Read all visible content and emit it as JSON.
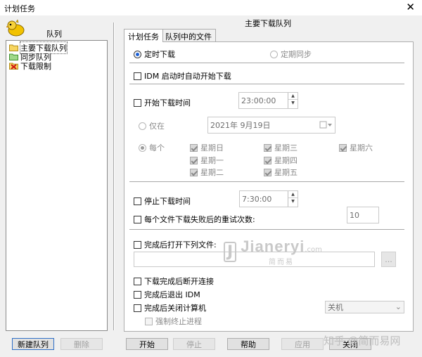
{
  "window": {
    "title": "计划任务",
    "close_glyph": "✕"
  },
  "left_panel": {
    "label": "队列",
    "items": [
      {
        "label": "主要下载队列",
        "icon": "folder-queue-icon"
      },
      {
        "label": "同步队列",
        "icon": "sync-queue-icon"
      },
      {
        "label": "下载限制",
        "icon": "limit-x-icon"
      }
    ],
    "new_queue_button": "新建队列",
    "delete_button": "删除"
  },
  "right_panel": {
    "title": "主要下载队列",
    "tabs": [
      "计划任务",
      "队列中的文件"
    ],
    "one_time_download": "定时下载",
    "periodic_sync": "定期同步",
    "start_on_idm_start": "IDM 启动时自动开始下载",
    "start_download_time": {
      "label": "开始下载时间",
      "value": "23:00:00"
    },
    "only_on": {
      "label": "仅在",
      "date": "2021年  9月19日"
    },
    "every": {
      "label": "每个",
      "days": [
        {
          "label": "星期日",
          "checked": true
        },
        {
          "label": "星期一",
          "checked": true
        },
        {
          "label": "星期二",
          "checked": true
        },
        {
          "label": "星期三",
          "checked": true
        },
        {
          "label": "星期四",
          "checked": true
        },
        {
          "label": "星期五",
          "checked": true
        },
        {
          "label": "星期六",
          "checked": true
        }
      ]
    },
    "stop_download_time": {
      "label": "停止下载时间",
      "value": "7:30:00"
    },
    "retry": {
      "label": "每个文件下载失败后的重试次数:",
      "value": "10"
    },
    "open_file_after": {
      "label": "完成后打开下列文件:",
      "browse": "..."
    },
    "hang_up": "下载完成后断开连接",
    "exit_idm": "完成后退出 IDM",
    "shutdown": {
      "label": "完成后关闭计算机",
      "option": "关机"
    },
    "force_kill": "强制终止进程"
  },
  "footer": {
    "start": "开始",
    "stop": "停止",
    "help": "帮助",
    "apply": "应用",
    "close": "关闭"
  },
  "watermark": {
    "logo": "J",
    "main": "Jianeryi",
    "tld": ".com",
    "sub": "简而易",
    "corner": "知乎 @简而易网"
  }
}
